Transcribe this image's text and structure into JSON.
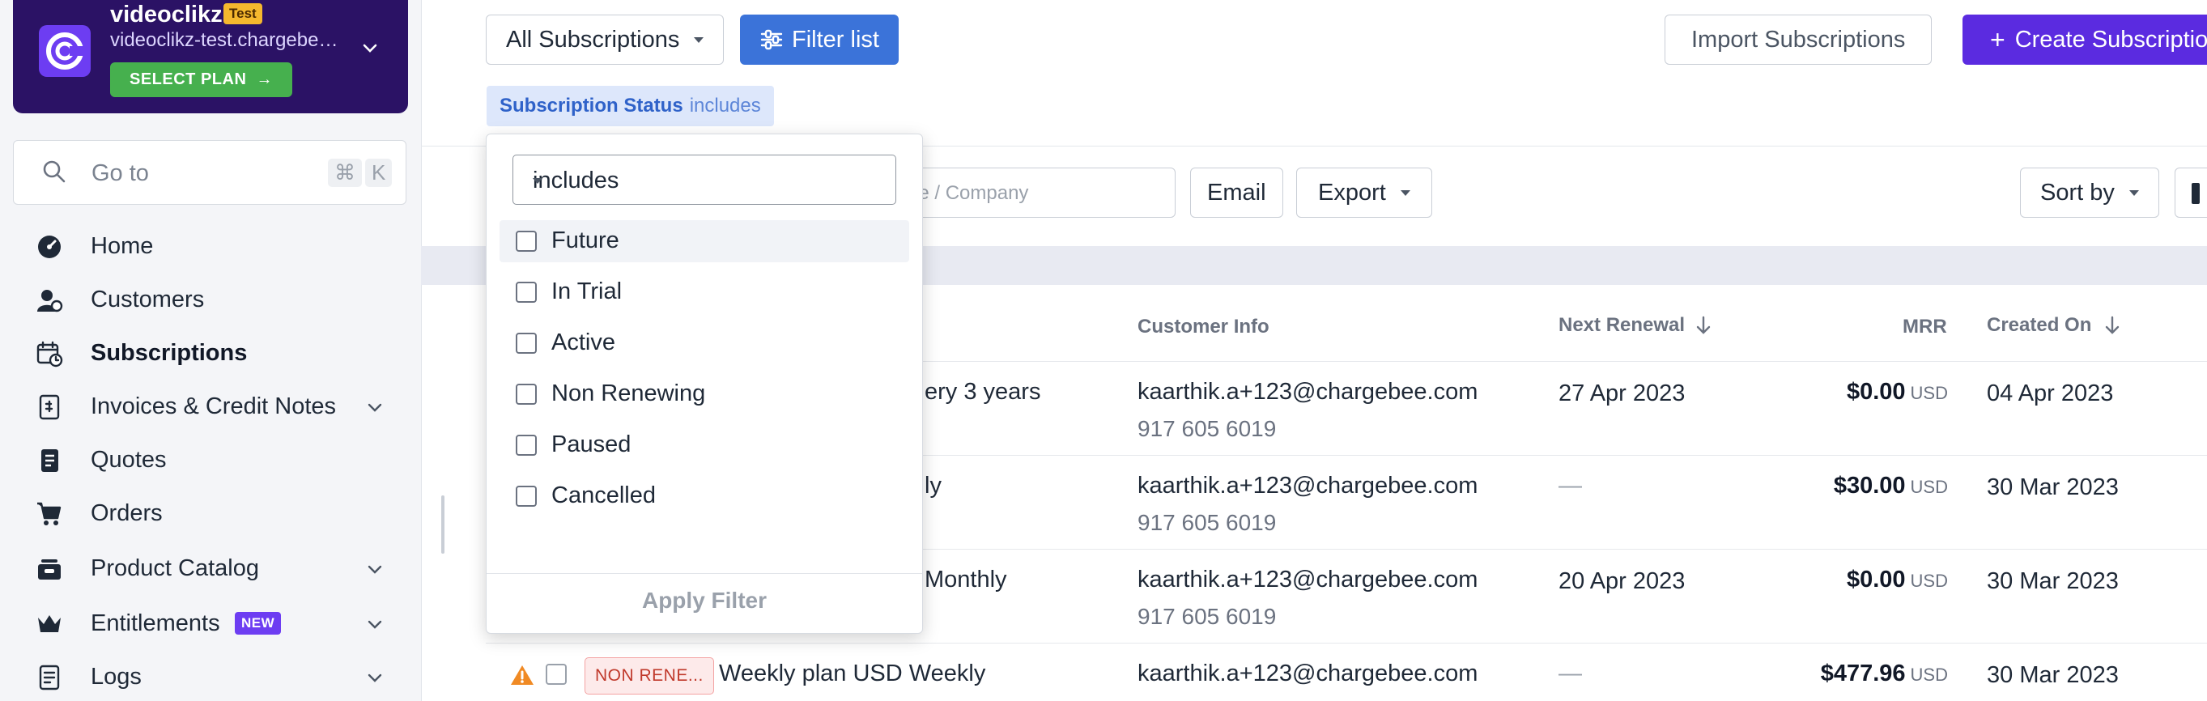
{
  "site": {
    "name": "videoclikz",
    "env_badge": "Test",
    "domain": "videoclikz-test.chargebee.com",
    "select_plan": "SELECT PLAN"
  },
  "goto": {
    "label": "Go to",
    "shortcut_cmd": "⌘",
    "shortcut_key": "K"
  },
  "sidebar": {
    "items": [
      {
        "label": "Home",
        "icon": "dashboard-icon"
      },
      {
        "label": "Customers",
        "icon": "customers-icon"
      },
      {
        "label": "Subscriptions",
        "icon": "subscriptions-icon",
        "active": true
      },
      {
        "label": "Invoices & Credit Notes",
        "icon": "invoice-icon",
        "expandable": true
      },
      {
        "label": "Quotes",
        "icon": "quotes-icon"
      },
      {
        "label": "Orders",
        "icon": "cart-icon"
      },
      {
        "label": "Product Catalog",
        "icon": "catalog-icon",
        "expandable": true
      },
      {
        "label": "Entitlements",
        "icon": "crown-icon",
        "expandable": true,
        "badge": "NEW"
      },
      {
        "label": "Logs",
        "icon": "logs-icon",
        "expandable": true
      }
    ]
  },
  "header": {
    "view_select": "All Subscriptions",
    "filter_button": "Filter list",
    "import_button": "Import Subscriptions",
    "create_button": "Create Subscription"
  },
  "filter_chip": {
    "field": "Subscription Status",
    "operator": "includes"
  },
  "toolbar": {
    "search_placeholder_visible": "ne / Company",
    "email_button": "Email",
    "export_button": "Export",
    "sort_button": "Sort by"
  },
  "table": {
    "columns": {
      "customer": "Customer Info",
      "renewal": "Next Renewal",
      "mrr": "MRR",
      "created": "Created On"
    },
    "rows": [
      {
        "plan_partial": "ery 3 years",
        "email": "kaarthik.a+123@chargebee.com",
        "phone": "917 605 6019",
        "renewal": "27 Apr 2023",
        "mrr": "$0.00",
        "currency": "USD",
        "created": "04 Apr 2023"
      },
      {
        "plan_partial": "ly",
        "email": "kaarthik.a+123@chargebee.com",
        "phone": "917 605 6019",
        "renewal": "—",
        "mrr": "$30.00",
        "currency": "USD",
        "created": "30 Mar 2023"
      },
      {
        "plan_partial": "Monthly",
        "email": "kaarthik.a+123@chargebee.com",
        "phone": "917 605 6019",
        "renewal": "20 Apr 2023",
        "mrr": "$0.00",
        "currency": "USD",
        "created": "30 Mar 2023"
      },
      {
        "status": "NON RENE...",
        "plan": "Weekly plan USD Weekly",
        "email": "kaarthik.a+123@chargebee.com",
        "renewal": "—",
        "mrr": "$477.96",
        "currency": "USD",
        "created": "30 Mar 2023"
      }
    ]
  },
  "filter_popup": {
    "operator": "includes",
    "options": [
      "Future",
      "In Trial",
      "Active",
      "Non Renewing",
      "Paused",
      "Cancelled"
    ],
    "apply_label": "Apply Filter"
  }
}
